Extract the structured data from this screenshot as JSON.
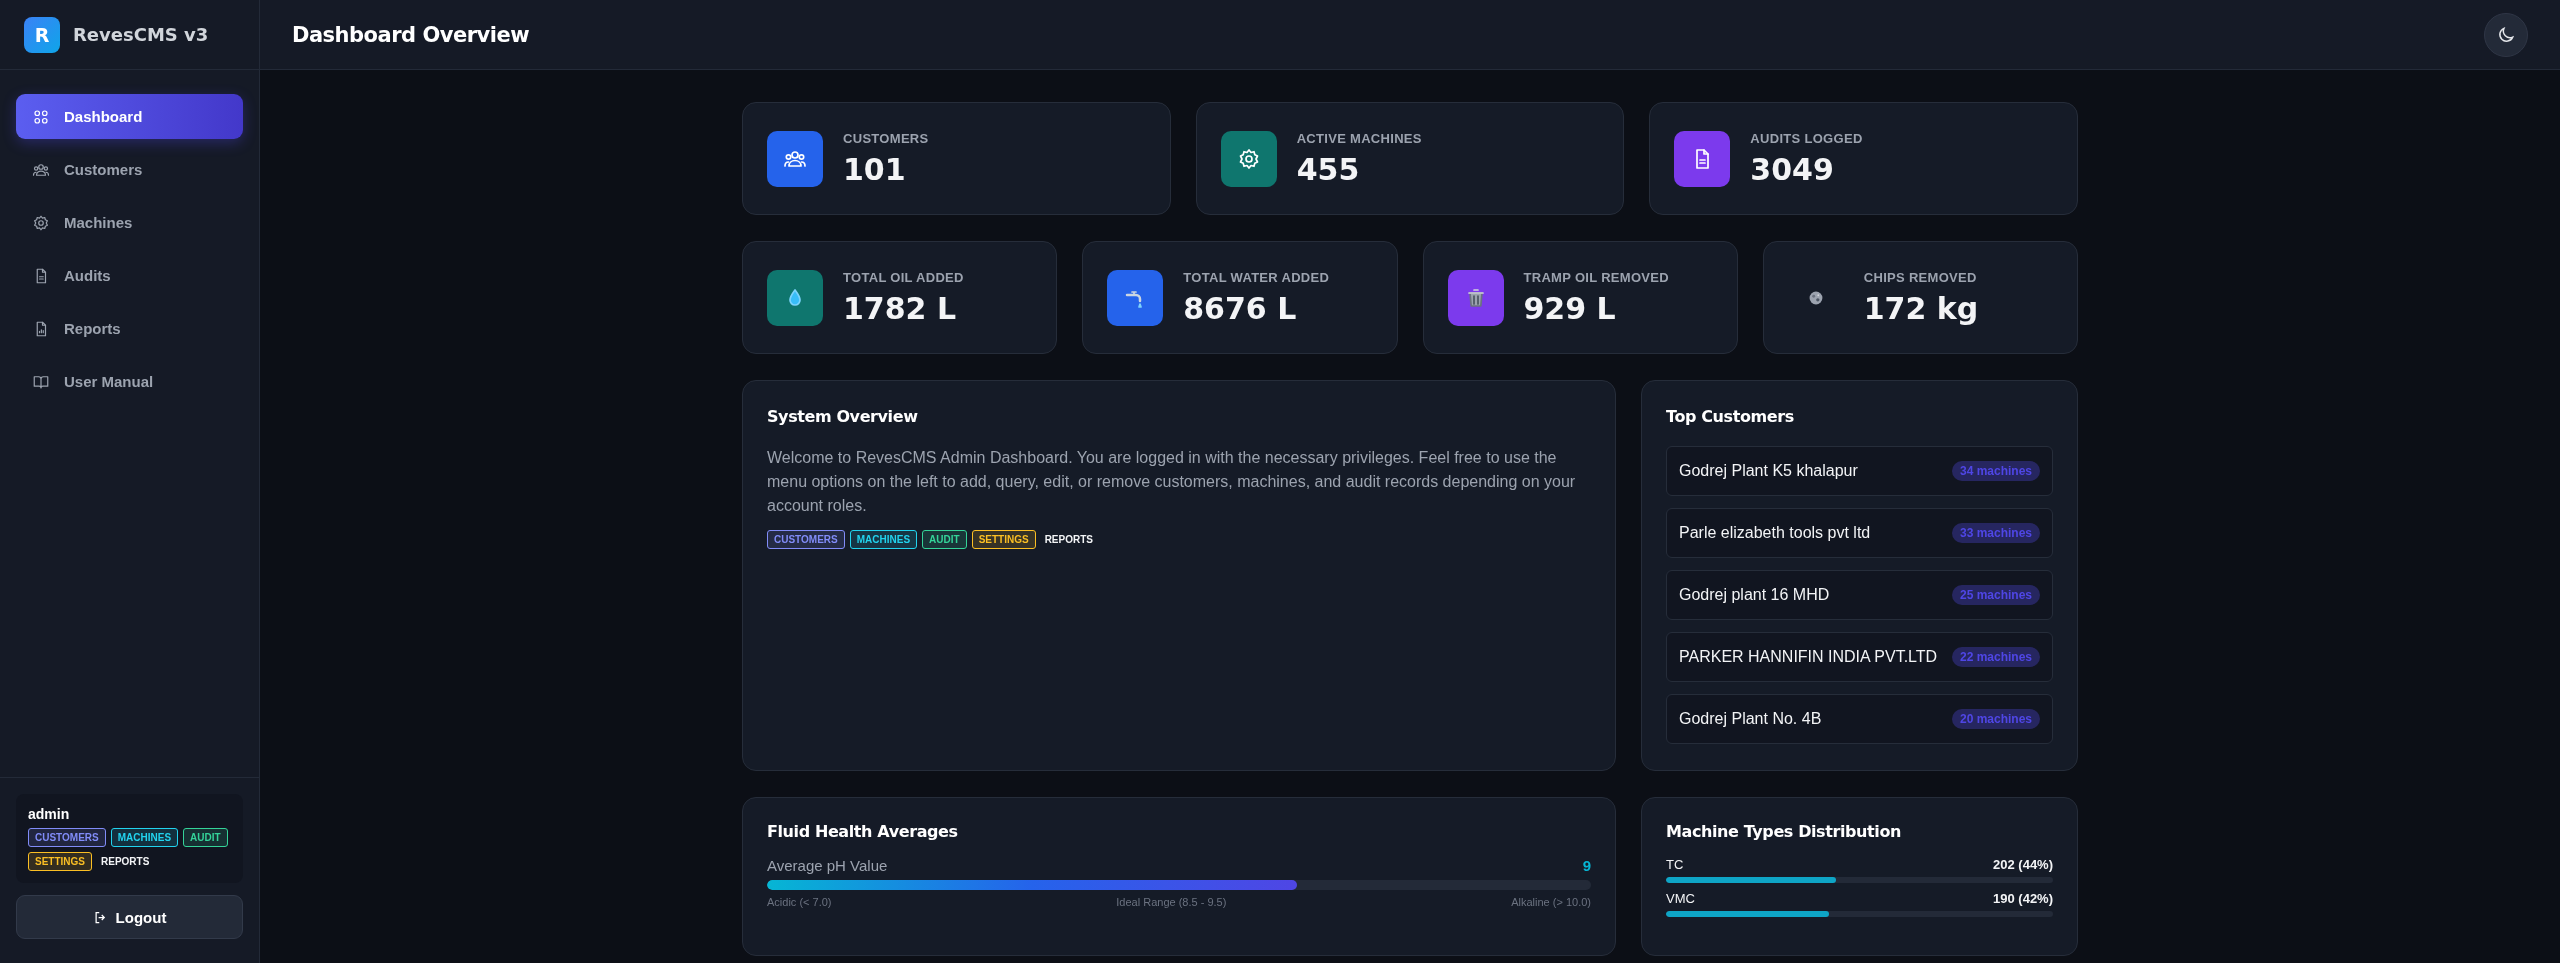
{
  "sidebar": {
    "logo_letter": "R",
    "brand": "RevesCMS v3",
    "items": [
      {
        "label": "Dashboard",
        "selected": true
      },
      {
        "label": "Customers",
        "selected": false
      },
      {
        "label": "Machines",
        "selected": false
      },
      {
        "label": "Audits",
        "selected": false
      },
      {
        "label": "Reports",
        "selected": false
      },
      {
        "label": "User Manual",
        "selected": false
      }
    ],
    "user": {
      "name": "admin",
      "roles": [
        {
          "label": "CUSTOMERS",
          "kind": "badge",
          "color": "#818cf8"
        },
        {
          "label": "MACHINES",
          "kind": "badge",
          "color": "#22d3ee"
        },
        {
          "label": "AUDIT",
          "kind": "badge",
          "color": "#34d399"
        },
        {
          "label": "SETTINGS",
          "kind": "badge",
          "color": "#fbbf24"
        },
        {
          "label": "REPORTS",
          "kind": "plain"
        }
      ]
    },
    "logout": "Logout"
  },
  "header": {
    "title": "Dashboard Overview"
  },
  "stats_top": [
    {
      "label": "CUSTOMERS",
      "value": "101",
      "color": "#2563eb"
    },
    {
      "label": "ACTIVE MACHINES",
      "value": "455",
      "color": "#0f766e"
    },
    {
      "label": "AUDITS LOGGED",
      "value": "3049",
      "color": "#7c3aed"
    }
  ],
  "stats_bottom": [
    {
      "label": "TOTAL OIL ADDED",
      "value": "1782 L",
      "color": "#0f766e"
    },
    {
      "label": "TOTAL WATER ADDED",
      "value": "8676 L",
      "color": "#2563eb"
    },
    {
      "label": "TRAMP OIL REMOVED",
      "value": "929 L",
      "color": "#7c3aed"
    },
    {
      "label": "CHIPS REMOVED",
      "value": "172 kg"
    }
  ],
  "system_overview": {
    "title": "System Overview",
    "text": "Welcome to RevesCMS Admin Dashboard. You are logged in with the necessary privileges. Feel free to use the menu options on the left to add, query, edit, or remove customers, machines, and audit records depending on your account roles.",
    "roles": [
      {
        "label": "CUSTOMERS",
        "kind": "badge",
        "color": "#818cf8"
      },
      {
        "label": "MACHINES",
        "kind": "badge",
        "color": "#22d3ee"
      },
      {
        "label": "AUDIT",
        "kind": "badge",
        "color": "#34d399"
      },
      {
        "label": "SETTINGS",
        "kind": "badge",
        "color": "#fbbf24"
      },
      {
        "label": "REPORTS",
        "kind": "plain"
      }
    ]
  },
  "top_customers": {
    "title": "Top Customers",
    "items": [
      {
        "name": "Godrej Plant K5 khalapur",
        "count": "34 machines"
      },
      {
        "name": "Parle elizabeth tools pvt ltd",
        "count": "33 machines"
      },
      {
        "name": "Godrej plant 16 MHD",
        "count": "25 machines"
      },
      {
        "name": "PARKER HANNIFIN INDIA PVT.LTD",
        "count": "22 machines"
      },
      {
        "name": "Godrej Plant No. 4B",
        "count": "20 machines"
      }
    ]
  },
  "fluid_health": {
    "title": "Fluid Health Averages",
    "metrics": [
      {
        "label": "Average pH Value",
        "reading": "9",
        "level": 0.643,
        "scale": [
          "Acidic (< 7.0)",
          "Ideal Range (8.5 - 9.5)",
          "Alkaline (> 10.0)"
        ]
      }
    ]
  },
  "machine_types": {
    "title": "Machine Types Distribution",
    "items": [
      {
        "name": "TC",
        "reading": "202 (44%)",
        "level": 0.44
      },
      {
        "name": "VMC",
        "reading": "190 (42%)",
        "level": 0.42
      }
    ]
  }
}
